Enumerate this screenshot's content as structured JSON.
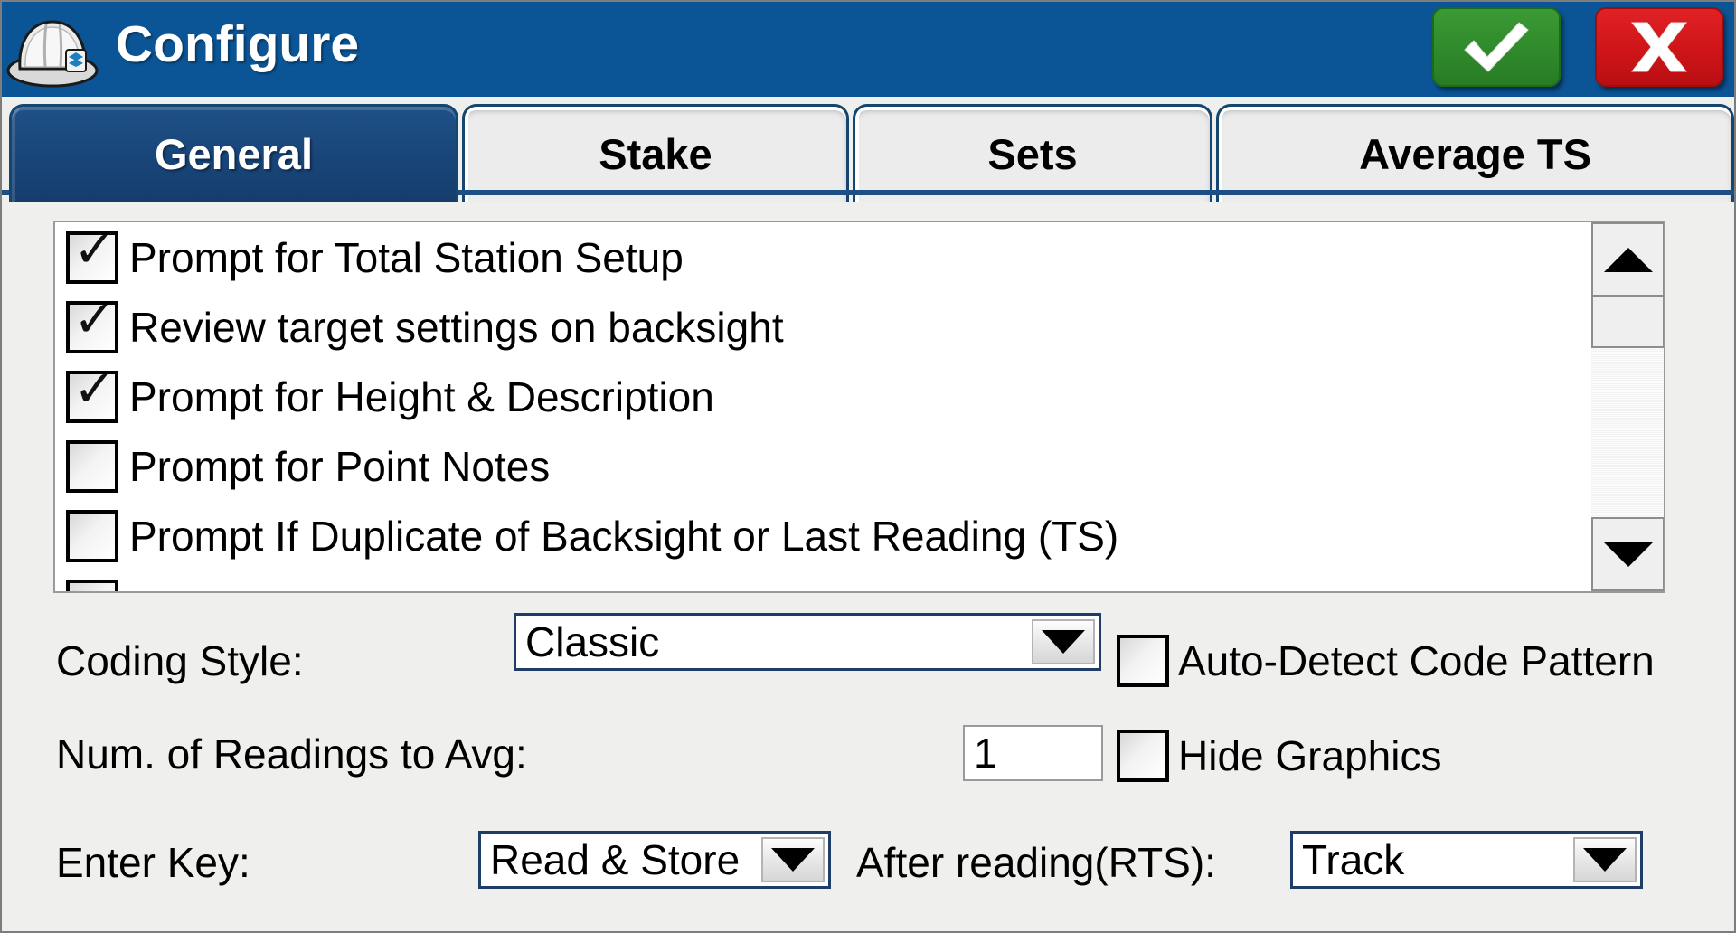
{
  "window": {
    "title": "Configure",
    "icon": "hardhat-icon",
    "accent_blue": "#0b5596",
    "tab_active_blue": "#1f5186",
    "ok_green": "#2f8a2b",
    "cancel_red": "#cf1418"
  },
  "titlebar_buttons": {
    "ok": {
      "name": "ok-button",
      "glyph": "✔"
    },
    "cancel": {
      "name": "cancel-button",
      "glyph": "X"
    }
  },
  "tabs": [
    {
      "label": "General",
      "active": true
    },
    {
      "label": "Stake",
      "active": false
    },
    {
      "label": "Sets",
      "active": false
    },
    {
      "label": "Average TS",
      "active": false
    }
  ],
  "checkbox_list": {
    "items": [
      {
        "label": "Prompt for Total Station Setup",
        "checked": true
      },
      {
        "label": "Review target settings on backsight",
        "checked": true
      },
      {
        "label": "Prompt for Height & Description",
        "checked": true
      },
      {
        "label": "Prompt for Point Notes",
        "checked": false
      },
      {
        "label": "Prompt If Duplicate of Backsight or Last Reading (TS)",
        "checked": false
      },
      {
        "label": "",
        "checked": false
      }
    ],
    "scrollbar": {
      "up_arrow": "scroll-up-icon",
      "down_arrow": "scroll-down-icon"
    }
  },
  "form": {
    "coding_style": {
      "label": "Coding Style:",
      "value": "Classic",
      "options": [
        "Classic"
      ]
    },
    "auto_detect": {
      "label": "Auto-Detect Code Pattern",
      "checked": false
    },
    "num_readings": {
      "label": "Num. of Readings to Avg:",
      "value": "1"
    },
    "hide_graphics": {
      "label": "Hide Graphics",
      "checked": false
    },
    "enter_key": {
      "label": "Enter Key:",
      "value": "Read & Store",
      "options": [
        "Read & Store"
      ]
    },
    "after_reading": {
      "label": "After reading(RTS):",
      "value": "Track",
      "options": [
        "Track"
      ]
    }
  }
}
